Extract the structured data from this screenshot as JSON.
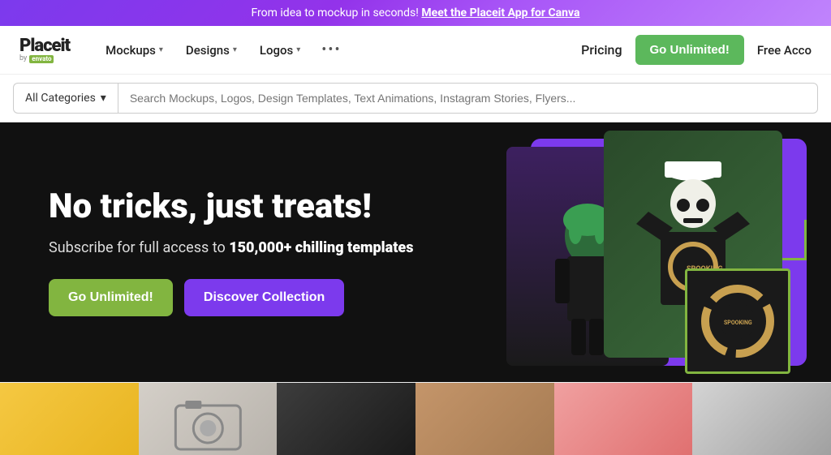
{
  "banner": {
    "text_before_link": "From idea to mockup in seconds!",
    "link_text": "Meet the Placeit App for Canva"
  },
  "navbar": {
    "logo": "Placeit",
    "logo_by": "by",
    "logo_brand": "envato",
    "nav_items": [
      {
        "label": "Mockups",
        "has_chevron": true
      },
      {
        "label": "Designs",
        "has_chevron": true
      },
      {
        "label": "Logos",
        "has_chevron": true
      }
    ],
    "pricing": "Pricing",
    "go_unlimited": "Go Unlimited!",
    "free_account": "Free Acco"
  },
  "search": {
    "category_label": "All Categories",
    "placeholder": "Search Mockups, Logos, Design Templates, Text Animations, Instagram Stories, Flyers..."
  },
  "hero": {
    "title": "No tricks, just treats!",
    "subtitle_prefix": "Subscribe for full access to ",
    "subtitle_highlight": "150,000+ chilling templates",
    "btn_unlimited": "Go Unlimited!",
    "btn_discover": "Discover Collection"
  },
  "bottom_thumbs": [
    {
      "id": "thumb-1",
      "color": "#f5c842"
    },
    {
      "id": "thumb-2",
      "color": "#d4cfc8"
    },
    {
      "id": "thumb-3",
      "color": "#3d3d3d"
    },
    {
      "id": "thumb-4",
      "color": "#c4956a"
    },
    {
      "id": "thumb-5",
      "color": "#f0a0a0"
    },
    {
      "id": "thumb-6",
      "color": "#d4d4d4"
    }
  ]
}
